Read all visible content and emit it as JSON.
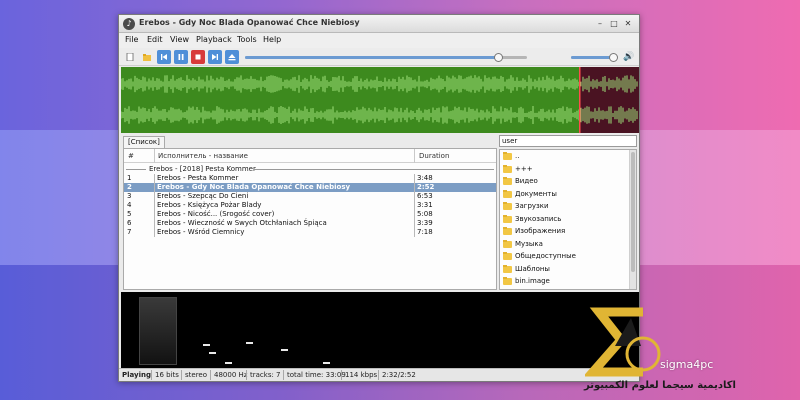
{
  "window": {
    "title": "Erebos - Gdy Noc Blada Opanować Chce Niebiosy",
    "controls": {
      "minimize": "–",
      "maximize": "□",
      "close": "✕"
    }
  },
  "menu": [
    "File",
    "Edit",
    "View",
    "Playback",
    "Tools",
    "Help"
  ],
  "toolbar": {
    "icons": [
      "new-playlist-icon",
      "open-folder-icon",
      "previous-icon",
      "pause-icon",
      "stop-icon",
      "next-icon",
      "eject-icon"
    ],
    "seek_progress": 0.9,
    "volume": 0.93
  },
  "tabs": [
    "[Список]"
  ],
  "playlist": {
    "columns": [
      "#",
      "Исполнитель - название",
      "Duration"
    ],
    "group": "Erebos - [2018] Pesta Kommer",
    "rows": [
      {
        "num": "1",
        "title": "Erebos - Pesta Kommer",
        "duration": "3:48"
      },
      {
        "num": "2",
        "title": "Erebos - Gdy Noc Blada Opanować Chce Niebiosy",
        "duration": "2:52"
      },
      {
        "num": "3",
        "title": "Erebos - Szepcąc Do Cieni",
        "duration": "6:53"
      },
      {
        "num": "4",
        "title": "Erebos - Księżyca Pożar Blady",
        "duration": "3:31"
      },
      {
        "num": "5",
        "title": "Erebos - Nicość... (Srogość cover)",
        "duration": "5:08"
      },
      {
        "num": "6",
        "title": "Erebos - Wieczność w Swych Otchłaniach Śpiąca",
        "duration": "3:39"
      },
      {
        "num": "7",
        "title": "Erebos - Wśród Ciemnicy",
        "duration": "7:18"
      }
    ],
    "selected_index": 1
  },
  "browser": {
    "path": "user",
    "items": [
      "..",
      "+++",
      "Видео",
      "Документы",
      "Загрузки",
      "Звукозапись",
      "Изображения",
      "Музыка",
      "Общедоступные",
      "Шаблоны",
      "bin.image"
    ]
  },
  "status": {
    "state": "Playing",
    "bits": "16 bits",
    "channels": "stereo",
    "rate": "48000 Hz",
    "tracks": "tracks: 7",
    "total": "total time: 33:09",
    "bitrate": "114 kbps",
    "position": "2:32/2:52"
  },
  "branding": {
    "logo_text": "sigma4pc",
    "arabic": "اكاديمية سيجما لعلوم الكمبيوتر"
  },
  "colors": {
    "waveform_played": "#3d8a1e",
    "waveform_future": "#4a1322",
    "selection": "#7c9dc4",
    "logo_gold": "#e0b534"
  }
}
